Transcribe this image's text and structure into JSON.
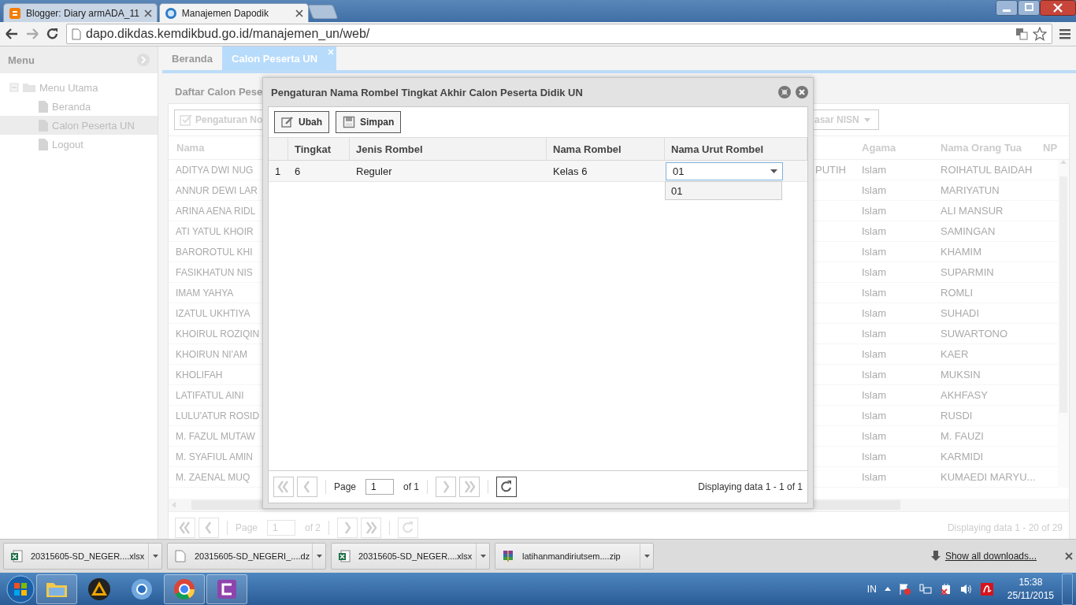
{
  "browser": {
    "tabs": [
      {
        "title": "Blogger: Diary armADA_11",
        "kind": "blogger",
        "selected": false
      },
      {
        "title": "Manajemen Dapodik",
        "kind": "site",
        "selected": true
      }
    ],
    "url": "dapo.dikdas.kemdikbud.go.id/manajemen_un/web/"
  },
  "sidebar": {
    "title": "Menu",
    "tree": [
      {
        "label": "Menu Utama",
        "expanded": true,
        "selected": false,
        "children": [
          {
            "label": "Beranda",
            "selected": false
          },
          {
            "label": "Calon Peserta UN",
            "selected": true
          },
          {
            "label": "Logout",
            "selected": false
          }
        ]
      }
    ]
  },
  "app_tabs": [
    {
      "label": "Beranda",
      "selected": false,
      "closable": false
    },
    {
      "label": "Calon Peserta UN",
      "selected": true,
      "closable": true
    }
  ],
  "panel": {
    "title": "Daftar Calon Pese",
    "toolbar": [
      {
        "label": "Pengaturan No",
        "kind": "button"
      },
      {
        "label": "asar NISN",
        "kind": "menu"
      }
    ],
    "columns": [
      "Nama",
      "Agama",
      "Nama Orang Tua",
      "NP"
    ],
    "rows": [
      {
        "nama": "ADITYA DWI NUG",
        "column_2": "PUTIH",
        "agama": "Islam",
        "nama_orang_tua": "ROIHATUL BAIDAH"
      },
      {
        "nama": "ANNUR DEWI LAR",
        "agama": "Islam",
        "nama_orang_tua": "MARIYATUN"
      },
      {
        "nama": "ARINA AENA RIDL",
        "agama": "Islam",
        "nama_orang_tua": "ALI MANSUR"
      },
      {
        "nama": "ATI YATUL KHOIR",
        "agama": "Islam",
        "nama_orang_tua": "SAMINGAN"
      },
      {
        "nama": "BAROROTUL KHI",
        "agama": "Islam",
        "nama_orang_tua": "KHAMIM"
      },
      {
        "nama": "FASIKHATUN NIS",
        "agama": "Islam",
        "nama_orang_tua": "SUPARMIN"
      },
      {
        "nama": "IMAM YAHYA",
        "agama": "Islam",
        "nama_orang_tua": "ROMLI"
      },
      {
        "nama": "IZATUL UKHTIYA",
        "agama": "Islam",
        "nama_orang_tua": "SUHADI"
      },
      {
        "nama": "KHOIRUL ROZIQIN",
        "agama": "Islam",
        "nama_orang_tua": "SUWARTONO"
      },
      {
        "nama": "KHOIRUN NI'AM",
        "agama": "Islam",
        "nama_orang_tua": "KAER"
      },
      {
        "nama": "KHOLIFAH",
        "agama": "Islam",
        "nama_orang_tua": "MUKSIN"
      },
      {
        "nama": "LATIFATUL AINI",
        "agama": "Islam",
        "nama_orang_tua": "AKHFASY"
      },
      {
        "nama": "LULU'ATUR ROSID",
        "agama": "Islam",
        "nama_orang_tua": "RUSDI"
      },
      {
        "nama": "M. FAZUL MUTAW",
        "agama": "Islam",
        "nama_orang_tua": "M. FAUZI"
      },
      {
        "nama": "M. SYAFIUL AMIN",
        "agama": "Islam",
        "nama_orang_tua": "KARMIDI"
      },
      {
        "nama": "M. ZAENAL MUQ",
        "agama": "Islam",
        "nama_orang_tua": "KUMAEDI MARYU..."
      }
    ],
    "pager": {
      "page_label": "Page",
      "page": "1",
      "of": "of 2",
      "display": "Displaying data 1 - 20 of 29"
    }
  },
  "dialog": {
    "title": "Pengaturan Nama Rombel Tingkat Akhir Calon Peserta Didik UN",
    "toolbar": [
      {
        "label": "Ubah",
        "kind": "edit"
      },
      {
        "label": "Simpan",
        "kind": "save"
      }
    ],
    "columns": [
      "Tingkat",
      "Jenis Rombel",
      "Nama Rombel",
      "Nama Urut Rombel"
    ],
    "rows": [
      {
        "number": "1",
        "tingkat": "6",
        "jenis_rombel": "Reguler",
        "nama_rombel": "Kelas 6",
        "nama_urut_rombel": "01"
      }
    ],
    "dropdown": {
      "expanded": true,
      "options": [
        {
          "label": "01"
        }
      ]
    },
    "pager": {
      "page_label": "Page",
      "page": "1",
      "of": "of 1",
      "display": "Displaying data 1 - 1 of 1"
    }
  },
  "downloads": {
    "items": [
      {
        "name": "20315605-SD_NEGER....xlsx",
        "kind": "excel"
      },
      {
        "name": "20315605-SD_NEGERI_....dz",
        "kind": "file"
      },
      {
        "name": "20315605-SD_NEGER....xlsx",
        "kind": "excel"
      },
      {
        "name": "latihanmandiriutsem....zip",
        "kind": "archive"
      }
    ],
    "show_all": "Show all downloads..."
  },
  "taskbar": {
    "apps": [
      {
        "kind": "explorer",
        "running": true
      },
      {
        "kind": "player",
        "running": false
      },
      {
        "kind": "chromium",
        "running": false
      },
      {
        "kind": "chrome",
        "running": true
      },
      {
        "kind": "purple",
        "running": true
      }
    ],
    "language": "IN",
    "time": "15:38",
    "date": "25/11/2015"
  }
}
